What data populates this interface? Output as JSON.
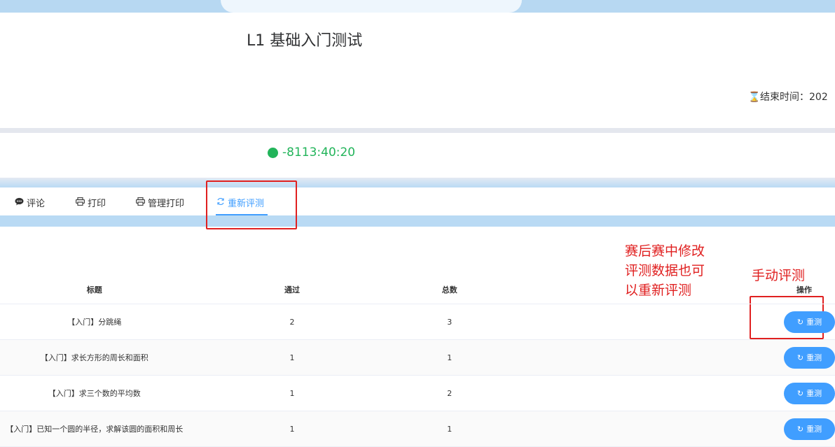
{
  "header": {
    "title": "L1 基础入门测试",
    "end_time_label": "结束时间：202",
    "hourglass_icon": "hourglass-icon"
  },
  "timer": {
    "value": "-8113:40:20",
    "status_color": "#22b45a"
  },
  "tabs": [
    {
      "label": "评论",
      "icon": "comment-icon"
    },
    {
      "label": "打印",
      "icon": "printer-icon"
    },
    {
      "label": "管理打印",
      "icon": "printer-icon"
    },
    {
      "label": "重新评测",
      "icon": "refresh-icon",
      "active": true
    }
  ],
  "annotations": {
    "note1_line1": "赛后赛中修改",
    "note1_line2": "评测数据也可",
    "note1_line3": "以重新评测",
    "note2": "手动评测"
  },
  "table": {
    "columns": [
      "标题",
      "通过",
      "总数",
      "操作"
    ],
    "rows": [
      {
        "title": "【入门】分跳绳",
        "passed": "2",
        "total": "3",
        "action": "重测"
      },
      {
        "title": "【入门】求长方形的周长和面积",
        "passed": "1",
        "total": "1",
        "action": "重测"
      },
      {
        "title": "【入门】求三个数的平均数",
        "passed": "1",
        "total": "2",
        "action": "重测"
      },
      {
        "title": "【入门】已知一个圆的半径，求解该圆的面积和周长",
        "passed": "1",
        "total": "1",
        "action": "重测"
      }
    ]
  },
  "colors": {
    "accent": "#409eff",
    "annotation_red": "#e02020"
  }
}
